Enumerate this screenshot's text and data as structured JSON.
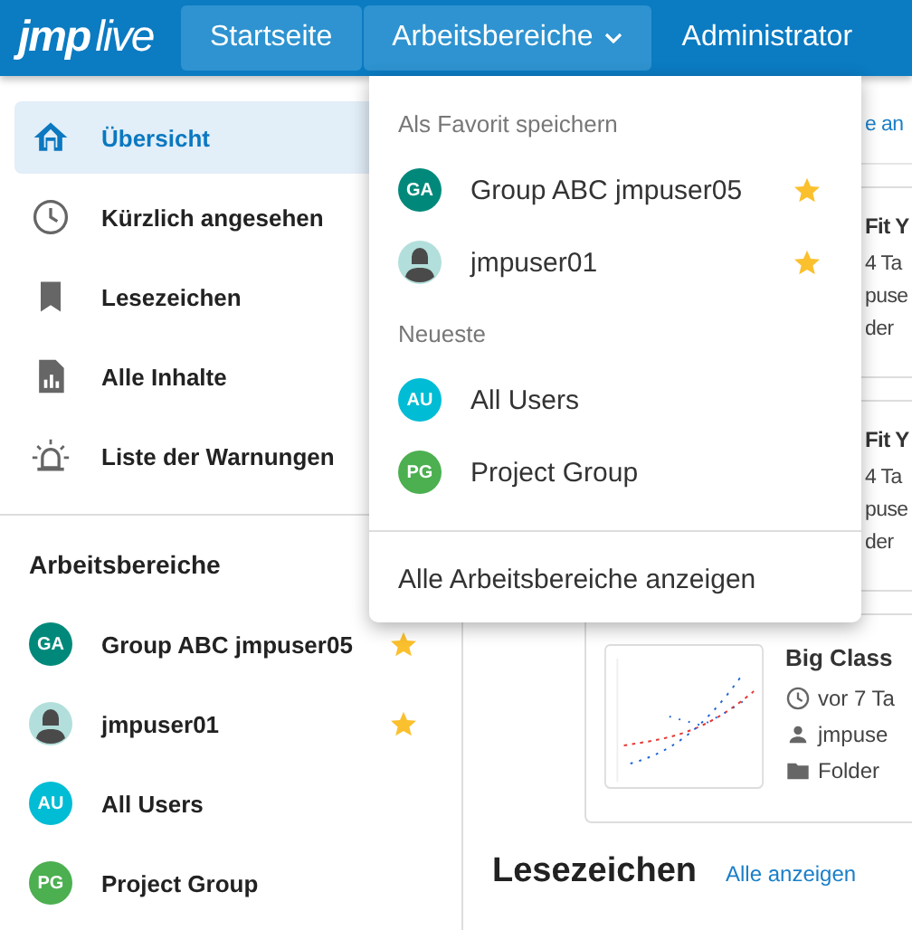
{
  "header": {
    "logo_brand": "jmp",
    "logo_product": "live",
    "nav": [
      {
        "label": "Startseite",
        "highlighted": true,
        "has_menu": false
      },
      {
        "label": "Arbeitsbereiche",
        "highlighted": true,
        "has_menu": true
      },
      {
        "label": "Administrator",
        "highlighted": false,
        "has_menu": false
      }
    ]
  },
  "sidebar": {
    "items": [
      {
        "label": "Übersicht",
        "selected": true
      },
      {
        "label": "Kürzlich angesehen",
        "selected": false
      },
      {
        "label": "Lesezeichen",
        "selected": false
      },
      {
        "label": "Alle Inhalte",
        "selected": false
      },
      {
        "label": "Liste der Warnungen",
        "selected": false
      }
    ],
    "workspaces_title": "Arbeitsbereiche",
    "workspaces": [
      {
        "kind": "initials",
        "initials": "GA",
        "color": "#00897b",
        "name": "Group ABC jmpuser05",
        "favorite": true
      },
      {
        "kind": "user",
        "name": "jmpuser01",
        "favorite": true
      },
      {
        "kind": "initials",
        "initials": "AU",
        "color": "#00bcd4",
        "name": "All Users",
        "favorite": false
      },
      {
        "kind": "initials",
        "initials": "PG",
        "color": "#4caf50",
        "name": "Project Group",
        "favorite": false
      }
    ]
  },
  "main": {
    "top_link": "e an",
    "cards": [
      {
        "kind": "partial",
        "title": "Fit Y",
        "lines": [
          "4 Ta",
          "puse",
          "der"
        ]
      },
      {
        "kind": "partial",
        "title": "Fit Y",
        "lines": [
          "4 Ta",
          "puse",
          "der"
        ]
      },
      {
        "kind": "full",
        "title": "Big Class",
        "lines": [
          "vor 7 Ta",
          "jmpuse",
          "Folder"
        ]
      }
    ],
    "section": {
      "title": "Lesezeichen",
      "link": "Alle anzeigen"
    }
  },
  "dropdown": {
    "sections": [
      {
        "label": "Als Favorit speichern",
        "items": [
          {
            "kind": "initials",
            "initials": "GA",
            "color": "#00897b",
            "name": "Group ABC jmpuser05",
            "favorite": true
          },
          {
            "kind": "user",
            "name": "jmpuser01",
            "favorite": true
          }
        ]
      },
      {
        "label": "Neueste",
        "items": [
          {
            "kind": "initials",
            "initials": "AU",
            "color": "#00bcd4",
            "name": "All Users",
            "favorite": false
          },
          {
            "kind": "initials",
            "initials": "PG",
            "color": "#4caf50",
            "name": "Project Group",
            "favorite": false
          }
        ]
      }
    ],
    "footer": "Alle Arbeitsbereiche anzeigen"
  }
}
